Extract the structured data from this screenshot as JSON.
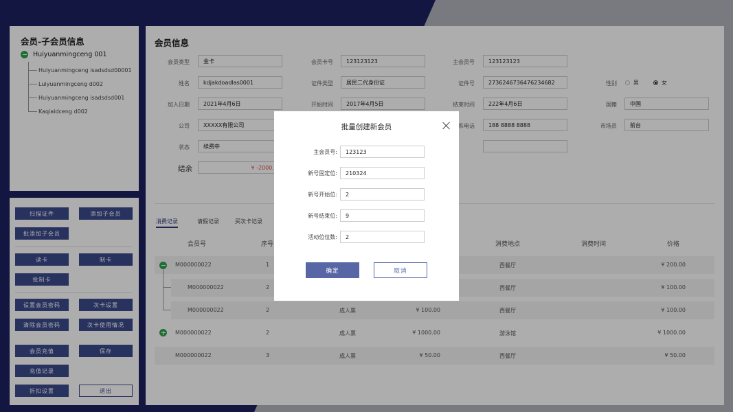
{
  "tree": {
    "title": "会员-子会员信息",
    "root": "Huiyuanmingceng 001",
    "children": [
      "Huiyuanmingceng isadsdsd00001",
      "Luiyuanmingceng d002",
      "Huiyuanmingceng isadsdsd001",
      "Kaqiaidceng d002"
    ]
  },
  "actions": {
    "scan_id": "扫描证件",
    "add_sub": "添加子会员",
    "batch_add_sub": "批添加子会员",
    "read_card": "读卡",
    "make_card": "制卡",
    "batch_make_card": "批制卡",
    "set_password": "设置会员密码",
    "card_settings": "次卡设置",
    "clear_password": "清除会员密码",
    "card_usage": "次卡使用情况",
    "recharge": "会员充值",
    "save": "保存",
    "recharge_records": "充值记录",
    "discount_settings": "折扣设置",
    "exit": "退出"
  },
  "member": {
    "title": "会员信息",
    "type_label": "会员类型",
    "type_value": "金卡",
    "card_no_label": "会员卡号",
    "card_no_value": "123123123",
    "main_no_label": "主会员号",
    "main_no_value": "123123123",
    "name_label": "姓名",
    "name_value": "kdjakdoadlas0001",
    "id_type_label": "证件类型",
    "id_type_value": "居民二代身份证",
    "id_no_label": "证件号",
    "id_no_value": "2736246736476234682",
    "gender_label": "性别",
    "gender_male": "男",
    "gender_female": "女",
    "join_label": "加入日期",
    "join_value": "2021年4月6日",
    "start_label": "开始时间",
    "start_value": "2017年4月5日",
    "end_label": "结束时间",
    "end_value": "222年4月6日",
    "nation_label": "国籍",
    "nation_value": "中国",
    "company_label": "公司",
    "company_value": "XXXXX有限公司",
    "phone_label_partial": "系电话",
    "phone_value": "188 8888 8888",
    "market_label": "市场员",
    "market_value": "前台",
    "status_label": "状态",
    "status_value": "续费中",
    "balance_label": "结余",
    "balance_value": "¥ -2000.0"
  },
  "colors": {
    "navy": "#1b2160",
    "button": "#3c4a8c",
    "accent_green": "#2ea44f",
    "negative": "#d9534f"
  },
  "tabs": [
    "消费记录",
    "请假记录",
    "买次卡记录"
  ],
  "table": {
    "headers": [
      "会员号",
      "序号",
      "消费地点",
      "消费时间",
      "价格"
    ],
    "rows": [
      {
        "member": "M000000022",
        "seq": "1",
        "type": "",
        "amount": "",
        "place": "西餐厅",
        "price": "¥ 200.00"
      },
      {
        "member": "M000000022",
        "seq": "2",
        "type": "",
        "amount": "",
        "place": "西餐厅",
        "price": "¥ 100.00"
      },
      {
        "member": "M000000022",
        "seq": "2",
        "type": "成人票",
        "amount": "¥ 100.00",
        "place": "西餐厅",
        "price": "¥ 100.00"
      },
      {
        "member": "M000000022",
        "seq": "2",
        "type": "成人票",
        "amount": "¥ 1000.00",
        "place": "游泳馆",
        "price": "¥ 1000.00"
      },
      {
        "member": "M000000022",
        "seq": "3",
        "type": "成人票",
        "amount": "¥ 50.00",
        "place": "西餐厅",
        "price": "¥ 50.00"
      }
    ]
  },
  "modal": {
    "title": "批量创建新会员",
    "main_no_label": "主会员号:",
    "main_no_value": "123123",
    "fixed_label": "新号固定位:",
    "fixed_value": "210324",
    "start_label": "新号开始位:",
    "start_value": "2",
    "end_label": "新号结束位:",
    "end_value": "9",
    "active_label": "活动位位数:",
    "active_value": "2",
    "confirm": "确定",
    "cancel": "取消"
  }
}
